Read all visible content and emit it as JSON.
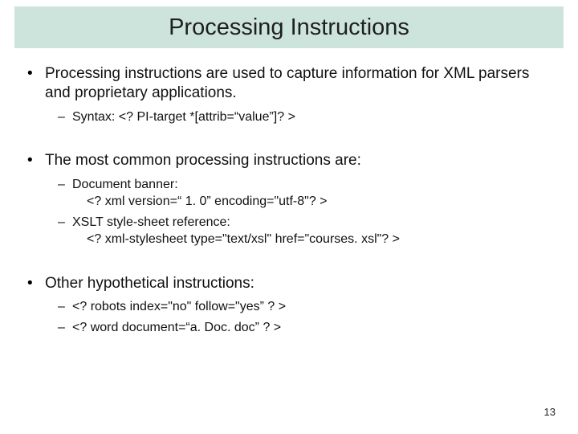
{
  "slide": {
    "title": "Processing Instructions",
    "pageNumber": "13",
    "bullets": [
      {
        "text": "Processing instructions are used to capture information for XML parsers and proprietary applications.",
        "sub": [
          {
            "text": "Syntax: <? PI-target *[attrib=“value”]? >"
          }
        ]
      },
      {
        "text": "The most common processing instructions are:",
        "sub": [
          {
            "text": "Document banner:",
            "cont": "<? xml version=“ 1. 0” encoding=\"utf-8\"? >"
          },
          {
            "text": "XSLT style-sheet reference:",
            "cont": "<? xml-stylesheet type=\"text/xsl\" href=\"courses. xsl\"? >"
          }
        ]
      },
      {
        "text": "Other hypothetical instructions:",
        "sub": [
          {
            "text": "<? robots index=\"no\" follow=\"yes” ? >"
          },
          {
            "text": "<? word document=“a. Doc. doc” ? >"
          }
        ]
      }
    ]
  }
}
